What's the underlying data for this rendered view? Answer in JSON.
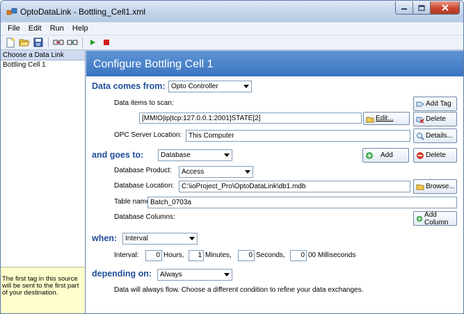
{
  "window": {
    "title": "OptoDataLink - Bottling_Cell1.xml"
  },
  "menu": [
    "File",
    "Edit",
    "Run",
    "Help"
  ],
  "toolbar": {
    "icons": [
      "new-icon",
      "open-icon",
      "save-icon",
      "link-icon",
      "unlink-icon",
      "run-icon",
      "stop-icon"
    ]
  },
  "sidebar": {
    "header": "Choose a Data Link",
    "items": [
      "Bottling Cell 1"
    ],
    "help": "The first tag in this source will be sent to the first part of your destination."
  },
  "main": {
    "title": "Configure Bottling Cell 1",
    "source": {
      "label": "Data comes from:",
      "selected": "Opto Controller",
      "items_label": "Data items to scan:",
      "item_value": "[MMIO|ip|tcp:127.0.0.1:2001]STATE[2]",
      "edit_btn": "Edit...",
      "add_tag_btn": "Add Tag",
      "delete_btn": "Delete",
      "opc_label": "OPC Server Location:",
      "opc_value": "This Computer",
      "details_btn": "Details..."
    },
    "destination": {
      "label": "and goes to:",
      "selected": "Database",
      "add_btn": "Add",
      "delete_btn": "Delete",
      "product_label": "Database Product:",
      "product_value": "Access",
      "location_label": "Database Location:",
      "location_value": "C:\\ioProject_Pro\\OptoDataLink\\db1.mdb",
      "browse_btn": "Browse...",
      "table_label": "Table name:",
      "table_value": "Batch_0703a",
      "columns_label": "Database Columns:",
      "add_column_btn": "Add Column"
    },
    "when": {
      "label": "when:",
      "selected": "Interval",
      "interval_label": "Interval:",
      "hours": "0",
      "hours_label": "Hours,",
      "minutes": "1",
      "minutes_label": "Minutes,",
      "seconds": "0",
      "seconds_label": "Seconds,",
      "ms": "0",
      "ms_label": "00 Milliseconds"
    },
    "depending": {
      "label": "depending on:",
      "selected": "Always",
      "note": "Data will always flow. Choose a different condition to refine your data exchanges."
    }
  }
}
